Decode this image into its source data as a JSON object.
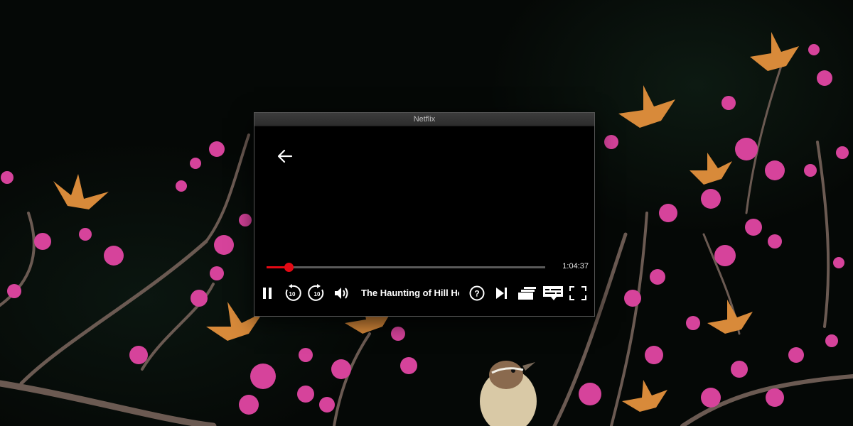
{
  "window": {
    "title": "Netflix"
  },
  "player": {
    "time_remaining": "1:04:37",
    "progress_fraction": 0.08,
    "episode_title": "The Haunting of Hill House",
    "replay_label": "10",
    "forward_label": "10",
    "help_label": "?"
  },
  "colors": {
    "accent": "#e50914",
    "track": "#5a5a5a",
    "icon": "#ffffff"
  },
  "icons": [
    "back-arrow-icon",
    "pause-icon",
    "replay-10-icon",
    "forward-10-icon",
    "volume-icon",
    "help-icon",
    "next-episode-icon",
    "episodes-icon",
    "subtitles-icon",
    "fullscreen-icon"
  ]
}
